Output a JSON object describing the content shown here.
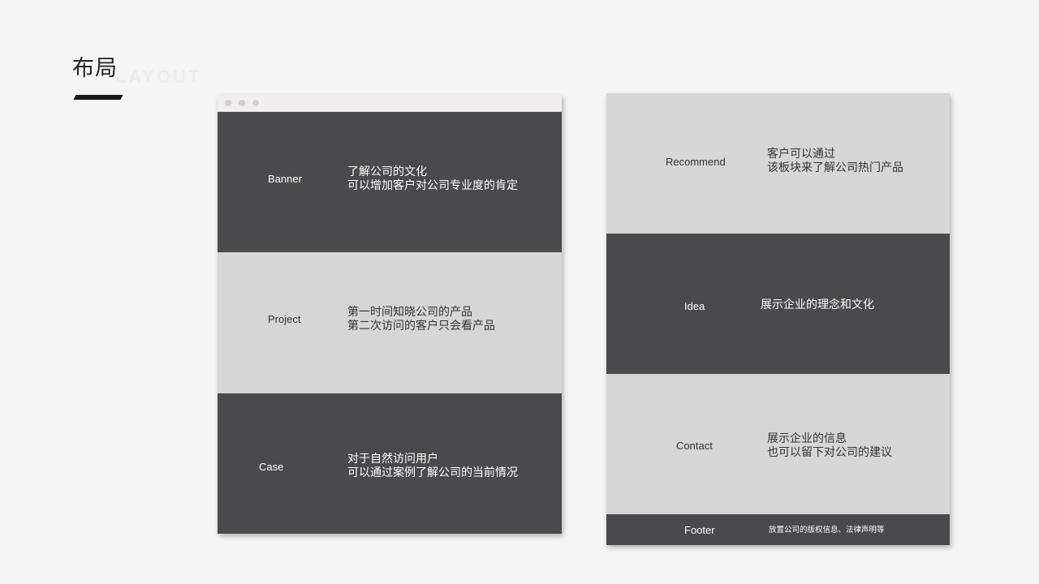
{
  "page": {
    "title": "布局",
    "subtitle": "LAYOUT"
  },
  "left_wireframe": {
    "sections": [
      {
        "label": "Banner",
        "lines": [
          "了解公司的文化",
          "可以增加客户对公司专业度的肯定"
        ]
      },
      {
        "label": "Project",
        "lines": [
          "第一时间知晓公司的产品",
          "第二次访问的客户只会看产品"
        ]
      },
      {
        "label": "Case",
        "lines": [
          "对于自然访问用户",
          "可以通过案例了解公司的当前情况"
        ]
      }
    ]
  },
  "right_wireframe": {
    "sections": [
      {
        "label": "Recommend",
        "lines": [
          "客户可以通过",
          "该板块来了解公司热门产品"
        ]
      },
      {
        "label": "Idea",
        "lines": [
          "展示企业的理念和文化"
        ]
      },
      {
        "label": "Contact",
        "lines": [
          "展示企业的信息",
          "也可以留下对公司的建议"
        ]
      }
    ],
    "footer": {
      "label": "Footer",
      "text": "放置公司的版权信息、法律声明等"
    }
  },
  "colors": {
    "dark_block": "#4a4a4c",
    "light_block": "#d6d6d6",
    "background": "#f5f5f5"
  }
}
